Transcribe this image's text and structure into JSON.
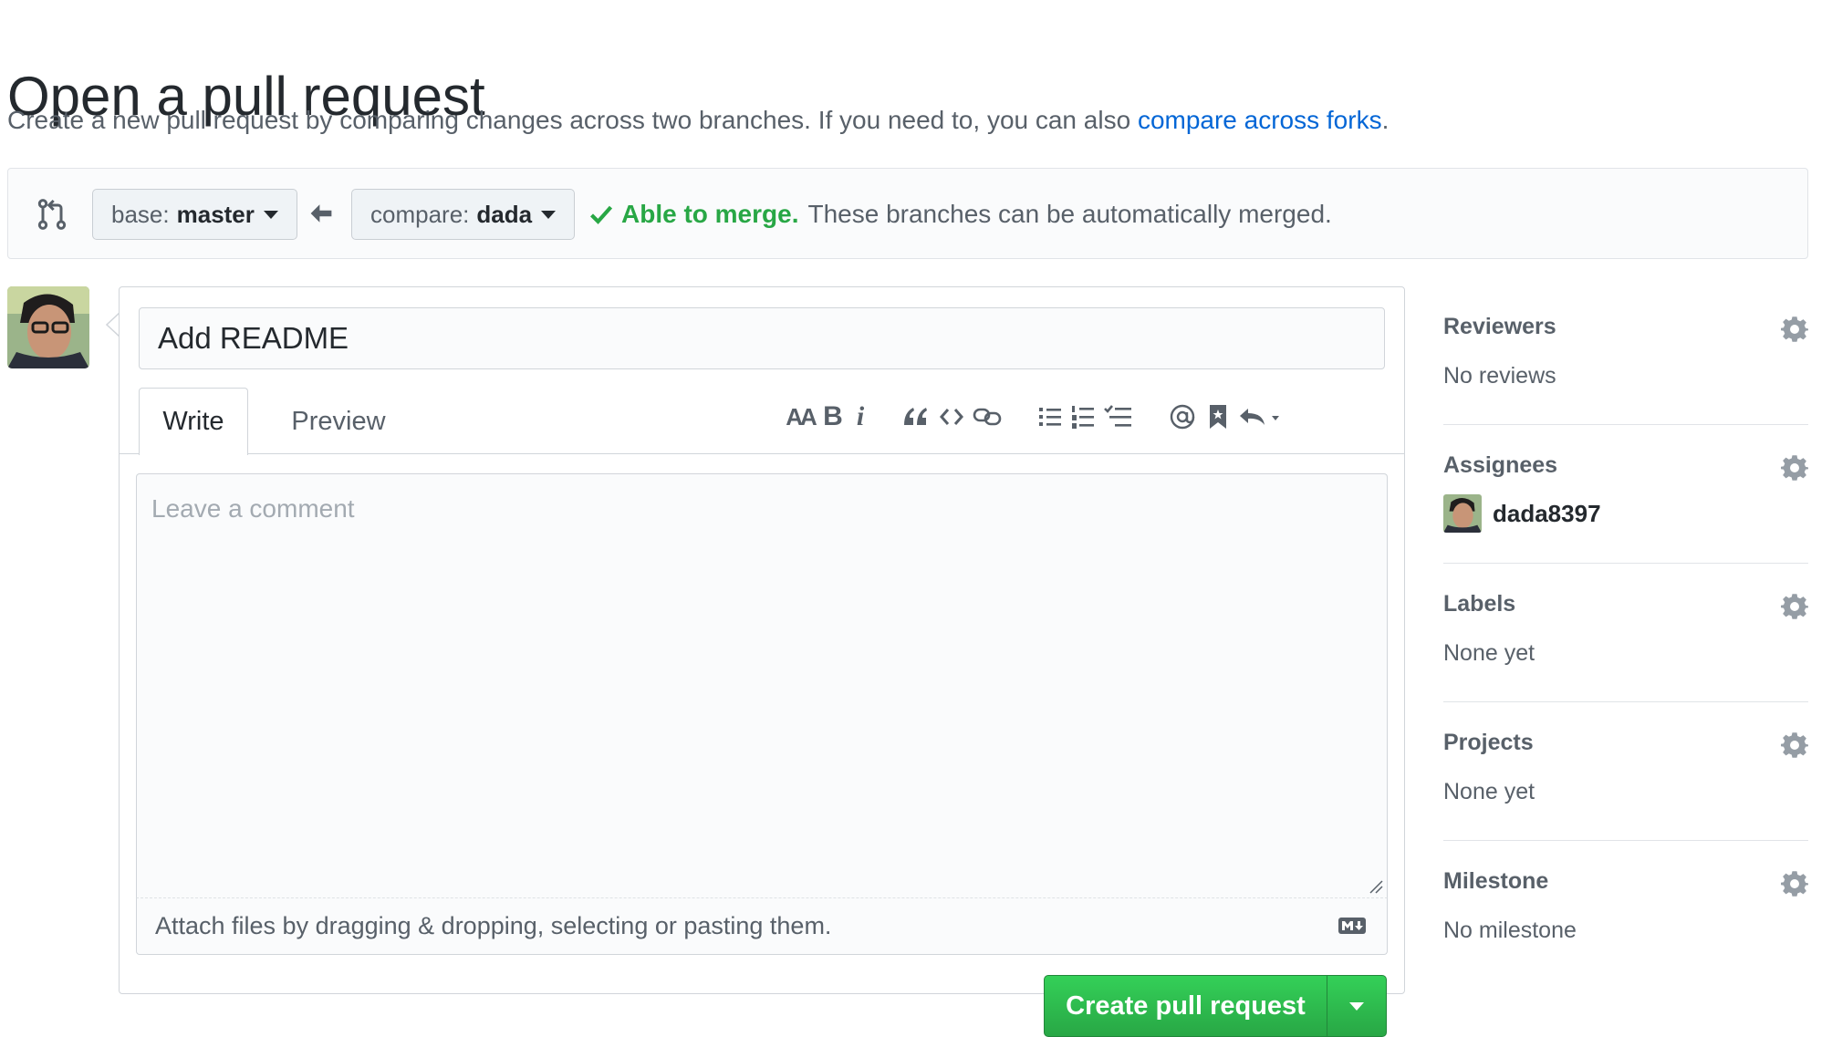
{
  "header": {
    "title": "Open a pull request",
    "subtitle_text": "Create a new pull request by comparing changes across two branches. If you need to, you can also ",
    "subtitle_link": "compare across forks",
    "subtitle_end": "."
  },
  "compare": {
    "base_prefix": "base:",
    "base_branch": "master",
    "compare_prefix": "compare:",
    "compare_branch": "dada",
    "merge_ok": "Able to merge.",
    "merge_text": "These branches can be automatically merged."
  },
  "editor": {
    "title_value": "Add README",
    "tab_write": "Write",
    "tab_preview": "Preview",
    "tool_header": "AA",
    "tool_bold": "B",
    "tool_italic": "i",
    "comment_placeholder": "Leave a comment",
    "attach_text": "Attach files by dragging & dropping, selecting or pasting them.",
    "submit_label": "Create pull request"
  },
  "sidebar": {
    "reviewers": {
      "heading": "Reviewers",
      "value": "No reviews"
    },
    "assignees": {
      "heading": "Assignees",
      "user": "dada8397"
    },
    "labels": {
      "heading": "Labels",
      "value": "None yet"
    },
    "projects": {
      "heading": "Projects",
      "value": "None yet"
    },
    "milestone": {
      "heading": "Milestone",
      "value": "No milestone"
    }
  },
  "colors": {
    "link": "#0366d6",
    "success": "#28a745",
    "button_green": "#2ea44f",
    "muted": "#586069"
  },
  "icons": [
    "git-pull-request-icon",
    "arrow-left-icon",
    "check-icon",
    "gear-icon",
    "markdown-icon",
    "avatar"
  ]
}
